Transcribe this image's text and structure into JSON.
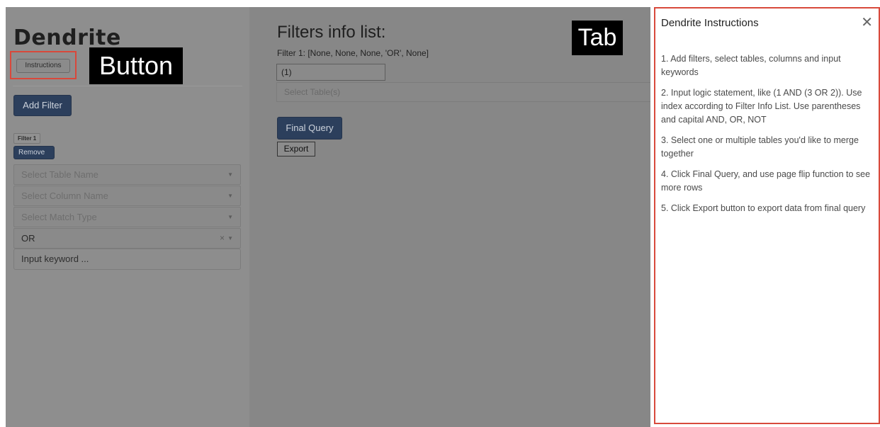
{
  "brand": "Dendrite",
  "annotations": {
    "button_tag": "Button",
    "tab_tag": "Tab"
  },
  "sidebar": {
    "instructions_button": "Instructions",
    "add_filter_button": "Add Filter",
    "filter": {
      "label": "Filter 1",
      "remove_button": "Remove",
      "table_placeholder": "Select Table Name",
      "column_placeholder": "Select Column Name",
      "match_type_placeholder": "Select Match Type",
      "logic_value": "OR",
      "keyword_placeholder": "Input keyword ..."
    }
  },
  "main": {
    "title": "Filters info list:",
    "filter_info": "Filter 1: [None, None, None, 'OR', None]",
    "logic_input_value": "(1)",
    "tables_placeholder": "Select Table(s)",
    "final_query_button": "Final Query",
    "export_button": "Export"
  },
  "instructions_panel": {
    "title": "Dendrite Instructions",
    "close_icon": "close-icon",
    "steps": [
      "1. Add filters, select tables, columns and input keywords",
      "2. Input logic statement, like (1 AND (3 OR 2)). Use index according to Filter Info List. Use parentheses and capital AND, OR, NOT",
      "3. Select one or multiple tables you'd like to merge together",
      "4. Click Final Query, and use page flip function to see more rows",
      "5. Click Export button to export data from final query"
    ]
  },
  "colors": {
    "highlight": "#d84a3c",
    "primary_button": "#2c3f5c",
    "overlay": "#888888"
  }
}
